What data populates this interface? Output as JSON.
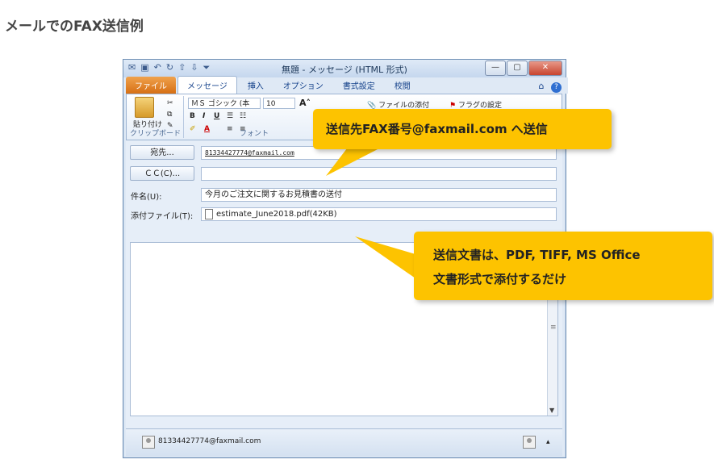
{
  "page": {
    "heading": "メールでのFAX送信例"
  },
  "window": {
    "title": "無題 - メッセージ (HTML 形式)",
    "controls": {
      "minimize": "—",
      "maximize": "▢",
      "close": "✕"
    }
  },
  "ribbon_tabs": [
    "ファイル",
    "メッセージ",
    "挿入",
    "オプション",
    "書式設定",
    "校閲"
  ],
  "ribbon": {
    "paste_label": "貼り付け",
    "clipboard_group": "クリップボード",
    "font_group": "フォント",
    "font_name": "ＭＳ ゴシック (本",
    "font_size": "10",
    "attach_file": "ファイルの添付",
    "flag": "フラグの設定"
  },
  "form": {
    "to_button": "宛先...",
    "to_value": "81334427774@faxmail.com",
    "cc_button": "ＣＣ(C)...",
    "cc_value": "",
    "subject_label": "件名(U):",
    "subject_value": "今月のご注文に関するお見積書の送付",
    "attach_label": "添付ファイル(T):",
    "attach_value": "estimate_June2018.pdf(42KB)"
  },
  "status": {
    "sender": "81334427774@faxmail.com"
  },
  "callouts": {
    "first": "送信先FAX番号@faxmail.com へ送信",
    "second_line1": "送信文書は、PDF, TIFF, MS Office",
    "second_line2": "文書形式で添付するだけ"
  },
  "colors": {
    "callout": "#fdc300",
    "file_tab": "#e07f1f",
    "window_bg": "#dfe9f5"
  }
}
